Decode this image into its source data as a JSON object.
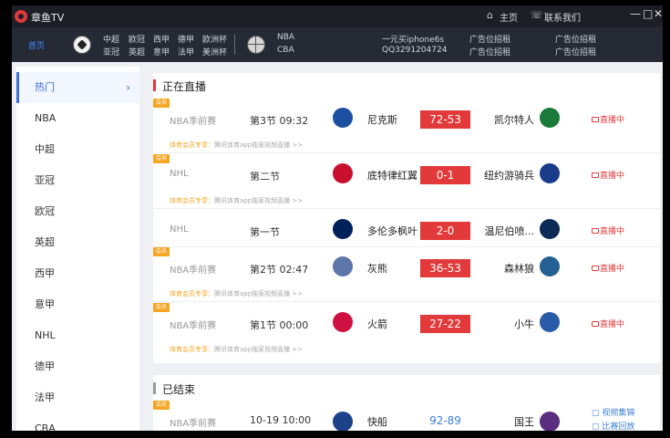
{
  "app": {
    "title": "章鱼TV"
  },
  "titlebar": {
    "home": "主页",
    "contact": "联系我们"
  },
  "nav": {
    "home": "首页",
    "soccer_col1": [
      "中超",
      "亚冠"
    ],
    "soccer_col2": [
      "欧冠",
      "英超"
    ],
    "soccer_col3": [
      "西甲",
      "意甲"
    ],
    "soccer_col4": [
      "德甲",
      "法甲"
    ],
    "soccer_col5": [
      "欧洲杯",
      "美洲杯"
    ],
    "basketball": [
      "NBA",
      "CBA"
    ],
    "ads": [
      "一元买iphone6s",
      "QQ3291204724",
      "广告位招租",
      "广告位招租",
      "广告位招租",
      "广告位招租"
    ]
  },
  "sidebar": {
    "items": [
      "热门",
      "NBA",
      "中超",
      "亚冠",
      "欧冠",
      "英超",
      "西甲",
      "意甲",
      "NHL",
      "德甲",
      "法甲",
      "CBA"
    ],
    "active": 0
  },
  "live_section": {
    "title": "正在直播"
  },
  "finished_section": {
    "title": "已结束"
  },
  "vip_label": "会员",
  "live_label": "直播中",
  "promo": {
    "highlight": "体育会员专享：",
    "text": "腾讯体育app独家视频直播 >>"
  },
  "matches": [
    {
      "vip": true,
      "league": "NBA季前赛",
      "period": "第3节 09:32",
      "home": "尼克斯",
      "score": "72-53",
      "away": "凯尔特人",
      "home_color": "#1d4fa0",
      "away_color": "#1a7a3a",
      "promo": true
    },
    {
      "vip": true,
      "league": "NHL",
      "period": "第二节",
      "home": "底特律红翼",
      "score": "0-1",
      "away": "纽约游骑兵",
      "home_color": "#c8102e",
      "away_color": "#1a3a8a",
      "promo": true
    },
    {
      "vip": false,
      "league": "NHL",
      "period": "第一节",
      "home": "多伦多枫叶",
      "score": "2-0",
      "away": "温尼伯喷...",
      "home_color": "#00205b",
      "away_color": "#0b2a55",
      "promo": false
    },
    {
      "vip": true,
      "league": "NBA季前赛",
      "period": "第2节 02:47",
      "home": "灰熊",
      "score": "36-53",
      "away": "森林狼",
      "home_color": "#5d76a9",
      "away_color": "#236192",
      "promo": true
    },
    {
      "vip": true,
      "league": "NBA季前赛",
      "period": "第1节 00:00",
      "home": "火箭",
      "score": "27-22",
      "away": "小牛",
      "home_color": "#ce1141",
      "away_color": "#2a5ba8",
      "promo": true
    }
  ],
  "finished": [
    {
      "vip": true,
      "league": "NBA季前赛",
      "period": "10-19 10:00",
      "home": "快船",
      "score": "92-89",
      "away": "国王",
      "home_color": "#1d428a",
      "away_color": "#5a2d81",
      "links": [
        "视频集锦",
        "比赛回放"
      ]
    }
  ]
}
